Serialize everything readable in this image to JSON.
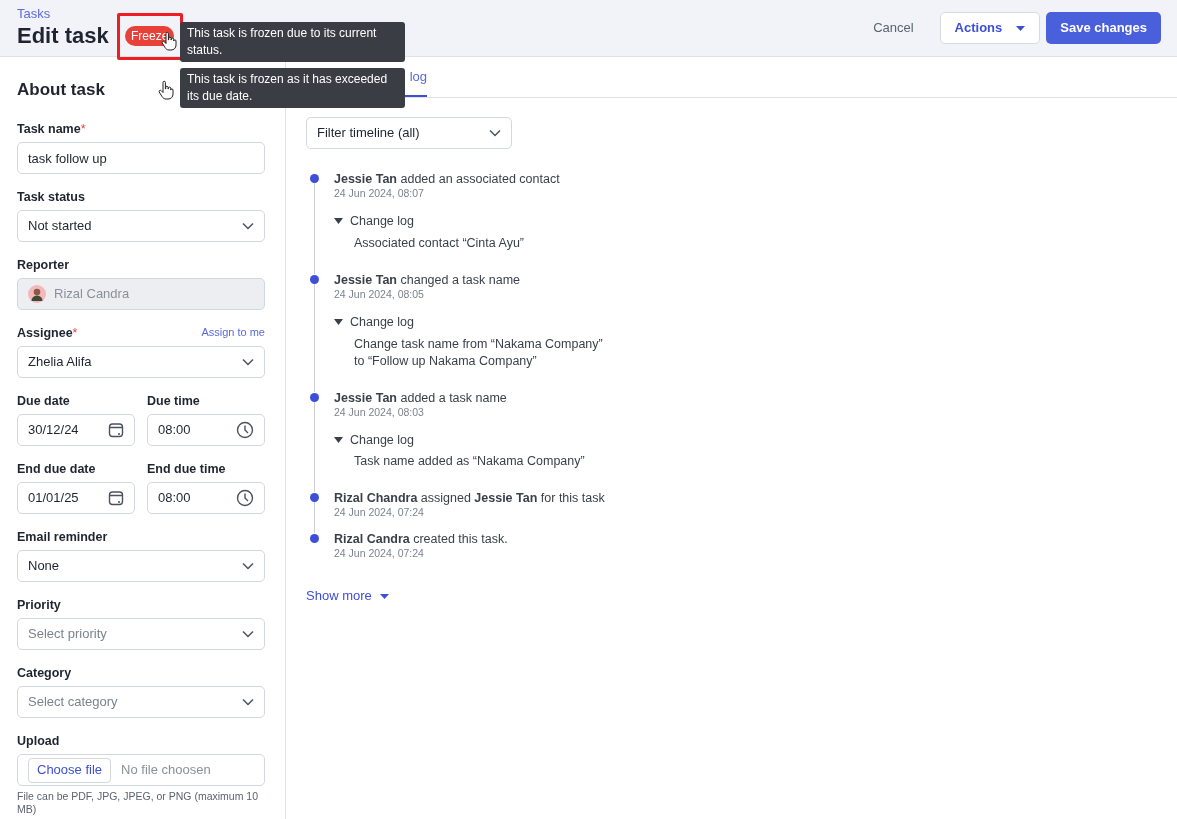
{
  "header": {
    "breadcrumb": "Tasks",
    "title": "Edit task",
    "badge": "Freeze",
    "cancel": "Cancel",
    "actions": "Actions",
    "save": "Save changes"
  },
  "tooltips": [
    "This task is frozen due to its current status.",
    "This task is frozen as it has exceeded its due date."
  ],
  "form": {
    "heading": "About task",
    "fields": [
      {
        "kind": "text",
        "label": "Task name",
        "required_mark": "*",
        "value": "task follow up"
      },
      {
        "kind": "select",
        "label": "Task status",
        "value": "Not started"
      },
      {
        "kind": "readonly",
        "label": "Reporter",
        "value": "Rizal Candra"
      },
      {
        "kind": "select",
        "label": "Assignee",
        "required_mark": "*",
        "value": "Zhelia Alifa",
        "link": "Assign to me"
      },
      {
        "kind": "pair",
        "items": [
          {
            "kind": "date",
            "label": "Due date",
            "value": "30/12/24"
          },
          {
            "kind": "time",
            "label": "Due time",
            "value": "08:00"
          }
        ]
      },
      {
        "kind": "pair",
        "items": [
          {
            "kind": "date",
            "label": "End due date",
            "value": "01/01/25"
          },
          {
            "kind": "time",
            "label": "End due time",
            "value": "08:00"
          }
        ]
      },
      {
        "kind": "select",
        "label": "Email reminder",
        "value": "None"
      },
      {
        "kind": "select",
        "label": "Priority",
        "placeholder": "Select priority"
      },
      {
        "kind": "select",
        "label": "Category",
        "placeholder": "Select category"
      },
      {
        "kind": "file",
        "label": "Upload",
        "button": "Choose file",
        "status": "No file choosen",
        "hint": "File can be PDF, JPG, JPEG, or PNG (maximum 10 MB)"
      }
    ]
  },
  "tabs": [
    {
      "label": "log",
      "selected": true
    }
  ],
  "filter": {
    "value": "Filter timeline (all)"
  },
  "timeline": [
    {
      "text": "**Jessie Tan** added an associated contact",
      "time": "24 Jun 2024, 08:07",
      "change_log": {
        "label": "Change log",
        "expanded": true,
        "lines": [
          "Associated contact “Cinta Ayu”"
        ]
      }
    },
    {
      "text": "**Jessie Tan** changed a task name",
      "time": "24 Jun 2024, 08:05",
      "change_log": {
        "label": "Change log",
        "expanded": true,
        "lines": [
          "Change task name from “Nakama Company”",
          "to “Follow up Nakama Company”"
        ]
      }
    },
    {
      "text": "**Jessie Tan** added a task name",
      "time": "24 Jun 2024, 08:03",
      "change_log": {
        "label": "Change log",
        "expanded": true,
        "lines": [
          "Task name added as “Nakama Company”"
        ]
      }
    },
    {
      "text": "**Rizal Chandra** assigned **Jessie Tan** for this task",
      "time": "24 Jun 2024, 07:24"
    },
    {
      "text": "**Rizal Candra** created this task.",
      "time": "24 Jun 2024, 07:24"
    }
  ],
  "show_more": "Show more"
}
